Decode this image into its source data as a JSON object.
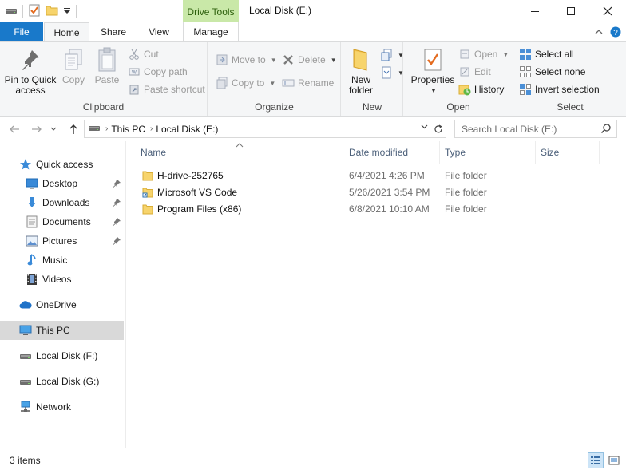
{
  "window": {
    "title": "Local Disk (E:)",
    "context_tab_group": "Drive Tools"
  },
  "tabs": {
    "file": "File",
    "home": "Home",
    "share": "Share",
    "view": "View",
    "manage": "Manage"
  },
  "ribbon": {
    "clipboard": {
      "label": "Clipboard",
      "pin_line1": "Pin to Quick",
      "pin_line2": "access",
      "copy": "Copy",
      "paste": "Paste",
      "cut": "Cut",
      "copy_path": "Copy path",
      "paste_shortcut": "Paste shortcut"
    },
    "organize": {
      "label": "Organize",
      "move_to": "Move to",
      "copy_to": "Copy to",
      "delete": "Delete",
      "rename": "Rename"
    },
    "new": {
      "label": "New",
      "new_folder_line1": "New",
      "new_folder_line2": "folder"
    },
    "open": {
      "label": "Open",
      "properties": "Properties",
      "open": "Open",
      "edit": "Edit",
      "history": "History"
    },
    "select": {
      "label": "Select",
      "select_all": "Select all",
      "select_none": "Select none",
      "invert_selection": "Invert selection"
    }
  },
  "address": {
    "crumbs": [
      "This PC",
      "Local Disk (E:)"
    ],
    "search_placeholder": "Search Local Disk (E:)"
  },
  "nav": {
    "quick_access": "Quick access",
    "desktop": "Desktop",
    "downloads": "Downloads",
    "documents": "Documents",
    "pictures": "Pictures",
    "music": "Music",
    "videos": "Videos",
    "onedrive": "OneDrive",
    "this_pc": "This PC",
    "disk_f": "Local Disk (F:)",
    "disk_g": "Local Disk (G:)",
    "network": "Network"
  },
  "columns": {
    "name": "Name",
    "date": "Date modified",
    "type": "Type",
    "size": "Size"
  },
  "files": [
    {
      "name": "H-drive-252765",
      "date": "6/4/2021 4:26 PM",
      "type": "File folder"
    },
    {
      "name": "Microsoft VS Code",
      "date": "5/26/2021 3:54 PM",
      "type": "File folder"
    },
    {
      "name": "Program Files (x86)",
      "date": "6/8/2021 10:10 AM",
      "type": "File folder"
    }
  ],
  "status": {
    "count": "3 items"
  },
  "colors": {
    "file_tab": "#1979ca",
    "drive_tools": "#c9e8a8",
    "folder": "#f7d46c",
    "selection": "#d9d9d9"
  }
}
